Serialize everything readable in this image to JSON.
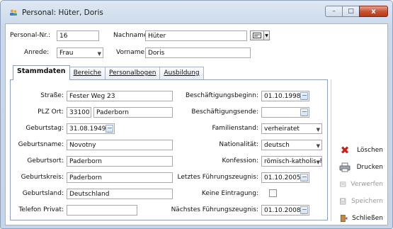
{
  "window": {
    "title": "Personal: Hüter, Doris",
    "btn_min": "–",
    "btn_max": "□",
    "btn_close": "x"
  },
  "header": {
    "personal_nr_label": "Personal-Nr.:",
    "personal_nr_value": "16",
    "nachname_label": "Nachname:",
    "nachname_value": "Hüter",
    "anrede_label": "Anrede:",
    "anrede_value": "Frau",
    "vorname_label": "Vorname:",
    "vorname_value": "Doris"
  },
  "tabs": [
    {
      "label": "Stammdaten",
      "active": true
    },
    {
      "label": "Bereiche",
      "active": false
    },
    {
      "label": "Personalbogen",
      "active": false
    },
    {
      "label": "Ausbildung",
      "active": false
    }
  ],
  "left": {
    "strasse_label": "Straße:",
    "strasse_value": "Fester Weg 23",
    "plz_label": "PLZ Ort:",
    "plz_value": "33100",
    "ort_value": "Paderborn",
    "geburtstag_label": "Geburtstag:",
    "geburtstag_value": "31.08.1949",
    "geburtsname_label": "Geburtsname:",
    "geburtsname_value": "Novotny",
    "geburtsort_label": "Geburtsort:",
    "geburtsort_value": "Paderborn",
    "geburtskreis_label": "Geburtskreis:",
    "geburtskreis_value": "Paderborn",
    "geburtsland_label": "Geburtsland:",
    "geburtsland_value": "Deutschland",
    "telefon_label": "Telefon Privat:",
    "telefon_value": ""
  },
  "right": {
    "beginn_label": "Beschäftigungsbeginn:",
    "beginn_value": "01.10.1998",
    "ende_label": "Beschäftigungsende:",
    "ende_value": "",
    "familienstand_label": "Familienstand:",
    "familienstand_value": "verheiratet",
    "nationalitaet_label": "Nationalität:",
    "nationalitaet_value": "deutsch",
    "konfession_label": "Konfession:",
    "konfession_value": "römisch-katholisch",
    "letztes_label": "Letztes Führungszeugnis:",
    "letztes_value": "01.10.2005",
    "keine_label": "Keine Eintragung:",
    "naechstes_label": "Nächstes Führungszeugnis:",
    "naechstes_value": "01.10.2008"
  },
  "sidebar": {
    "loeschen": "Löschen",
    "drucken": "Drucken",
    "verwerfen": "Verwerfen",
    "speichern": "Speichern",
    "schliessen": "Schließen"
  },
  "colors": {
    "loeschen_icon": "#c8201a",
    "titlebar": "#c9d8ea"
  }
}
